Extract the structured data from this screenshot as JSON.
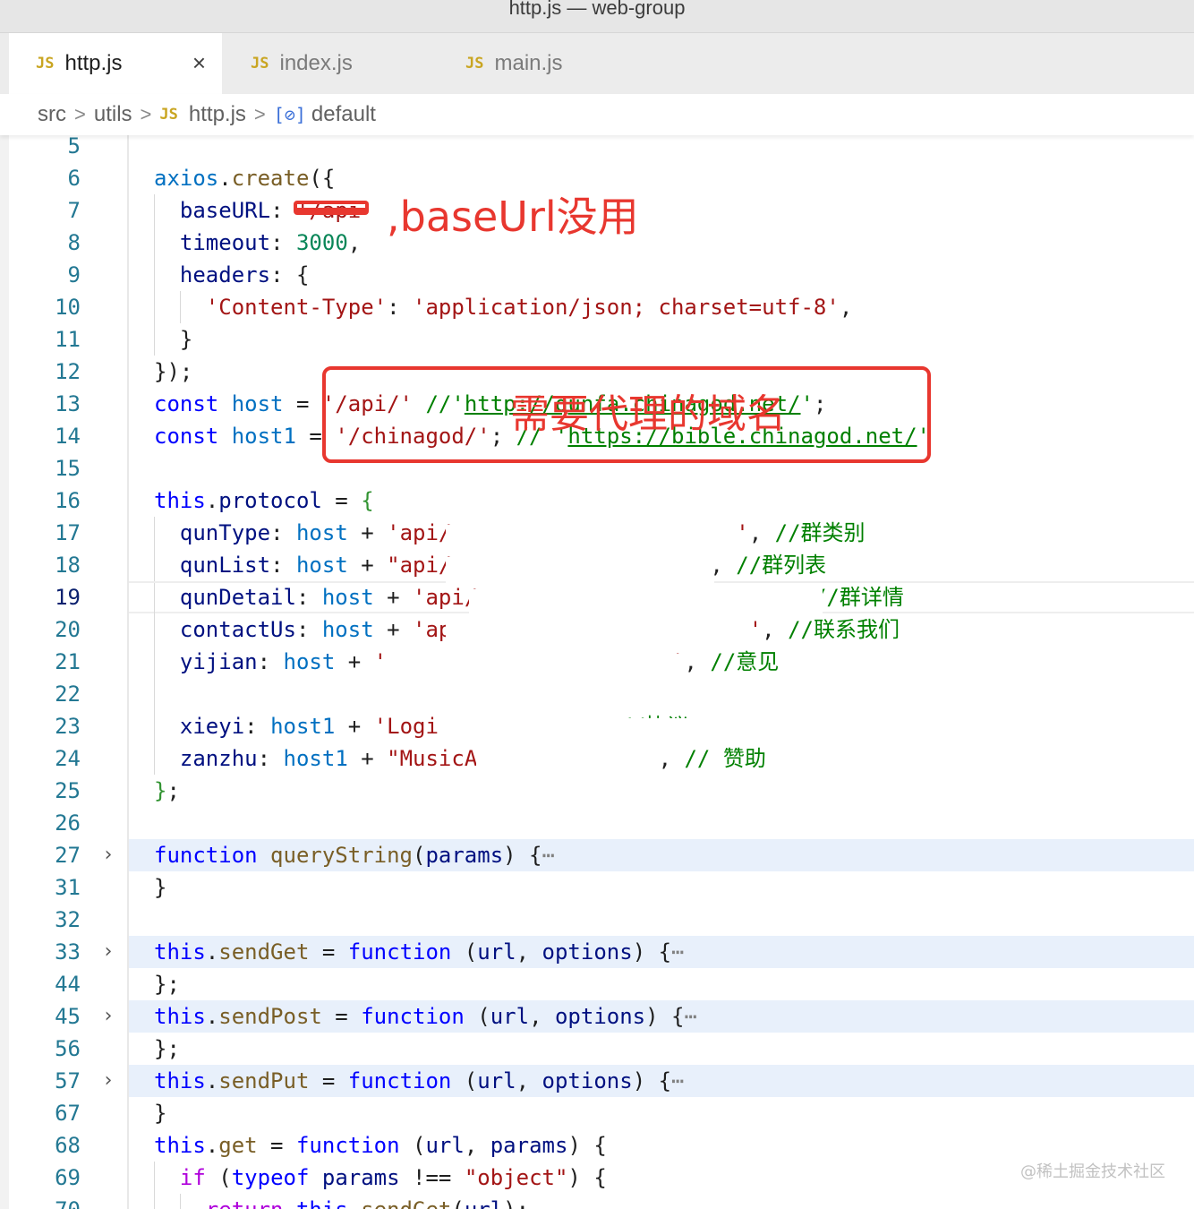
{
  "window": {
    "title": "http.js — web-group"
  },
  "tabs": [
    {
      "icon": "JS",
      "label": "http.js",
      "active": true,
      "close": "×"
    },
    {
      "icon": "JS",
      "label": "index.js",
      "active": false
    },
    {
      "icon": "JS",
      "label": "main.js",
      "active": false
    }
  ],
  "breadcrumb": {
    "items": [
      "src",
      "utils",
      "http.js",
      "default"
    ],
    "separator": ">",
    "file_icon": "JS",
    "symbol_icon": "[⊘]"
  },
  "annotations": {
    "baseurl_note": ",baseUrl没用",
    "domain_note": "需要代理的域名"
  },
  "watermark": "@稀土掘金技术社区",
  "colors": {
    "keyword": "#0000ff",
    "function": "#795e26",
    "property": "#001080",
    "variable": "#0070c1",
    "string": "#a31515",
    "number": "#098658",
    "comment": "#008000",
    "line_number": "#237893",
    "annotation_red": "#e8372f"
  },
  "code_lines": [
    {
      "n": "5",
      "indent": 0,
      "tokens": []
    },
    {
      "n": "6",
      "indent": 0,
      "tokens": [
        [
          "var",
          "axios"
        ],
        [
          "pun",
          "."
        ],
        [
          "fn",
          "create"
        ],
        [
          "pun",
          "({"
        ]
      ]
    },
    {
      "n": "7",
      "indent": 1,
      "tokens": [
        [
          "prop",
          "baseURL"
        ],
        [
          "pun",
          ": "
        ],
        [
          "str",
          "'/api'"
        ]
      ]
    },
    {
      "n": "8",
      "indent": 1,
      "tokens": [
        [
          "prop",
          "timeout"
        ],
        [
          "pun",
          ": "
        ],
        [
          "num",
          "3000"
        ],
        [
          "pun",
          ","
        ]
      ]
    },
    {
      "n": "9",
      "indent": 1,
      "tokens": [
        [
          "prop",
          "headers"
        ],
        [
          "pun",
          ": {"
        ]
      ]
    },
    {
      "n": "10",
      "indent": 2,
      "tokens": [
        [
          "str",
          "'Content-Type'"
        ],
        [
          "pun",
          ": "
        ],
        [
          "str",
          "'application/json; charset=utf-8'"
        ],
        [
          "pun",
          ","
        ]
      ]
    },
    {
      "n": "11",
      "indent": 1,
      "tokens": [
        [
          "pun",
          "}"
        ]
      ]
    },
    {
      "n": "12",
      "indent": 0,
      "tokens": [
        [
          "pun",
          "});"
        ]
      ]
    },
    {
      "n": "13",
      "indent": 0,
      "tokens": [
        [
          "kw",
          "const"
        ],
        [
          "pun",
          " "
        ],
        [
          "var",
          "host"
        ],
        [
          "pun",
          " = "
        ],
        [
          "str",
          "'/api/'"
        ],
        [
          "pun",
          " "
        ],
        [
          "cm",
          "//'"
        ],
        [
          "url",
          "http://qunfa.chinagod.net/"
        ],
        [
          "cm",
          "'"
        ],
        [
          "pun",
          ";"
        ]
      ]
    },
    {
      "n": "14",
      "indent": 0,
      "tokens": [
        [
          "kw",
          "const"
        ],
        [
          "pun",
          " "
        ],
        [
          "var",
          "host1"
        ],
        [
          "pun",
          " = "
        ],
        [
          "str",
          "'/chinagod/'"
        ],
        [
          "pun",
          "; "
        ],
        [
          "cm",
          "// '"
        ],
        [
          "url",
          "https://bible.chinagod.net/"
        ],
        [
          "cm",
          "'"
        ]
      ]
    },
    {
      "n": "15",
      "indent": 0,
      "tokens": []
    },
    {
      "n": "16",
      "indent": 0,
      "tokens": [
        [
          "kw",
          "this"
        ],
        [
          "pun",
          "."
        ],
        [
          "prop",
          "protocol"
        ],
        [
          "pun",
          " = "
        ],
        [
          "br",
          "{"
        ]
      ]
    },
    {
      "n": "17",
      "indent": 1,
      "tokens": [
        [
          "prop",
          "qunType"
        ],
        [
          "pun",
          ": "
        ],
        [
          "var",
          "host"
        ],
        [
          "pun",
          " + "
        ],
        [
          "str",
          "'api/"
        ],
        [
          "pun",
          "                      "
        ],
        [
          "str",
          "'"
        ],
        [
          "pun",
          ", "
        ],
        [
          "cm",
          "//群类别"
        ]
      ]
    },
    {
      "n": "18",
      "indent": 1,
      "tokens": [
        [
          "prop",
          "qunList"
        ],
        [
          "pun",
          ": "
        ],
        [
          "var",
          "host"
        ],
        [
          "pun",
          " + "
        ],
        [
          "str",
          "\"api/"
        ],
        [
          "pun",
          "                    , "
        ],
        [
          "cm",
          "//群列表"
        ]
      ]
    },
    {
      "n": "19",
      "indent": 1,
      "tokens": [
        [
          "prop",
          "qunDetail"
        ],
        [
          "pun",
          ": "
        ],
        [
          "var",
          "host"
        ],
        [
          "pun",
          " + "
        ],
        [
          "str",
          "'api/"
        ],
        [
          "pun",
          "                          "
        ],
        [
          "cm",
          "//群详情"
        ]
      ]
    },
    {
      "n": "20",
      "indent": 1,
      "tokens": [
        [
          "prop",
          "contactUs"
        ],
        [
          "pun",
          ": "
        ],
        [
          "var",
          "host"
        ],
        [
          "pun",
          " + "
        ],
        [
          "str",
          "'ap"
        ],
        [
          "pun",
          "                       "
        ],
        [
          "str",
          "'"
        ],
        [
          "pun",
          ", "
        ],
        [
          "cm",
          "//联系我们"
        ]
      ]
    },
    {
      "n": "21",
      "indent": 1,
      "tokens": [
        [
          "prop",
          "yijian"
        ],
        [
          "pun",
          ": "
        ],
        [
          "var",
          "host"
        ],
        [
          "pun",
          " + "
        ],
        [
          "str",
          "'"
        ],
        [
          "pun",
          "                      "
        ],
        [
          "str",
          "'"
        ],
        [
          "pun",
          ", "
        ],
        [
          "cm",
          "//意见"
        ]
      ]
    },
    {
      "n": "22",
      "indent": 1,
      "tokens": []
    },
    {
      "n": "23",
      "indent": 1,
      "tokens": [
        [
          "prop",
          "xieyi"
        ],
        [
          "pun",
          ": "
        ],
        [
          "var",
          "host1"
        ],
        [
          "pun",
          " + "
        ],
        [
          "str",
          "'Logi"
        ],
        [
          "pun",
          "              "
        ],
        [
          "cm",
          "//协议"
        ]
      ]
    },
    {
      "n": "24",
      "indent": 1,
      "tokens": [
        [
          "prop",
          "zanzhu"
        ],
        [
          "pun",
          ": "
        ],
        [
          "var",
          "host1"
        ],
        [
          "pun",
          " + "
        ],
        [
          "str",
          "\"MusicA"
        ],
        [
          "pun",
          "              , "
        ],
        [
          "cm",
          "// 赞助"
        ]
      ]
    },
    {
      "n": "25",
      "indent": 0,
      "tokens": [
        [
          "br",
          "}"
        ],
        [
          "pun",
          ";"
        ]
      ]
    },
    {
      "n": "26",
      "indent": 0,
      "tokens": []
    },
    {
      "n": "27",
      "indent": 0,
      "fold": true,
      "tokens": [
        [
          "kw",
          "function"
        ],
        [
          "pun",
          " "
        ],
        [
          "fn",
          "queryString"
        ],
        [
          "pun",
          "("
        ],
        [
          "prop",
          "params"
        ],
        [
          "pun",
          ") {"
        ],
        [
          "dim",
          "⋯"
        ]
      ]
    },
    {
      "n": "31",
      "indent": 0,
      "tokens": [
        [
          "pun",
          "}"
        ]
      ]
    },
    {
      "n": "32",
      "indent": 0,
      "tokens": []
    },
    {
      "n": "33",
      "indent": 0,
      "fold": true,
      "tokens": [
        [
          "kw",
          "this"
        ],
        [
          "pun",
          "."
        ],
        [
          "fn",
          "sendGet"
        ],
        [
          "pun",
          " = "
        ],
        [
          "kw",
          "function"
        ],
        [
          "pun",
          " ("
        ],
        [
          "prop",
          "url"
        ],
        [
          "pun",
          ", "
        ],
        [
          "prop",
          "options"
        ],
        [
          "pun",
          ") {"
        ],
        [
          "dim",
          "⋯"
        ]
      ]
    },
    {
      "n": "44",
      "indent": 0,
      "tokens": [
        [
          "pun",
          "};"
        ]
      ]
    },
    {
      "n": "45",
      "indent": 0,
      "fold": true,
      "tokens": [
        [
          "kw",
          "this"
        ],
        [
          "pun",
          "."
        ],
        [
          "fn",
          "sendPost"
        ],
        [
          "pun",
          " = "
        ],
        [
          "kw",
          "function"
        ],
        [
          "pun",
          " ("
        ],
        [
          "prop",
          "url"
        ],
        [
          "pun",
          ", "
        ],
        [
          "prop",
          "options"
        ],
        [
          "pun",
          ") {"
        ],
        [
          "dim",
          "⋯"
        ]
      ]
    },
    {
      "n": "56",
      "indent": 0,
      "tokens": [
        [
          "pun",
          "};"
        ]
      ]
    },
    {
      "n": "57",
      "indent": 0,
      "fold": true,
      "tokens": [
        [
          "kw",
          "this"
        ],
        [
          "pun",
          "."
        ],
        [
          "fn",
          "sendPut"
        ],
        [
          "pun",
          " = "
        ],
        [
          "kw",
          "function"
        ],
        [
          "pun",
          " ("
        ],
        [
          "prop",
          "url"
        ],
        [
          "pun",
          ", "
        ],
        [
          "prop",
          "options"
        ],
        [
          "pun",
          ") {"
        ],
        [
          "dim",
          "⋯"
        ]
      ]
    },
    {
      "n": "67",
      "indent": 0,
      "tokens": [
        [
          "pun",
          "}"
        ]
      ]
    },
    {
      "n": "68",
      "indent": 0,
      "tokens": [
        [
          "kw",
          "this"
        ],
        [
          "pun",
          "."
        ],
        [
          "fn",
          "get"
        ],
        [
          "pun",
          " = "
        ],
        [
          "kw",
          "function"
        ],
        [
          "pun",
          " ("
        ],
        [
          "prop",
          "url"
        ],
        [
          "pun",
          ", "
        ],
        [
          "prop",
          "params"
        ],
        [
          "pun",
          ") {"
        ]
      ]
    },
    {
      "n": "69",
      "indent": 1,
      "tokens": [
        [
          "kwc",
          "if"
        ],
        [
          "pun",
          " ("
        ],
        [
          "kw",
          "typeof"
        ],
        [
          "pun",
          " "
        ],
        [
          "prop",
          "params"
        ],
        [
          "pun",
          " !== "
        ],
        [
          "str",
          "\"object\""
        ],
        [
          "pun",
          ") {"
        ]
      ]
    },
    {
      "n": "70",
      "indent": 2,
      "tokens": [
        [
          "kwc",
          "return"
        ],
        [
          "pun",
          " "
        ],
        [
          "kw",
          "this"
        ],
        [
          "pun",
          "."
        ],
        [
          "fn",
          "sendGet"
        ],
        [
          "pun",
          "("
        ],
        [
          "prop",
          "url"
        ],
        [
          "pun",
          ");"
        ]
      ]
    }
  ],
  "current_line": "19"
}
